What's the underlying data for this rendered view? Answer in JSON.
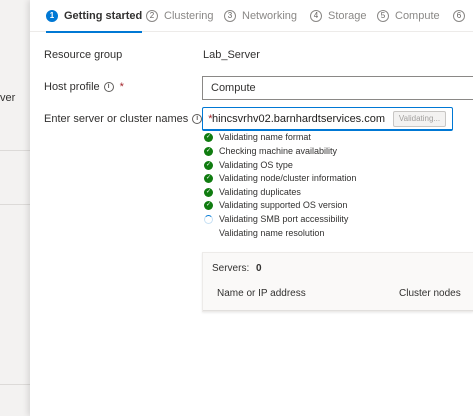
{
  "background": {
    "left_text": "ver"
  },
  "steps": [
    {
      "num": "1",
      "label": "Getting started",
      "active": true
    },
    {
      "num": "2",
      "label": "Clustering"
    },
    {
      "num": "3",
      "label": "Networking"
    },
    {
      "num": "4",
      "label": "Storage"
    },
    {
      "num": "5",
      "label": "Compute"
    },
    {
      "num": "6",
      "label": ""
    }
  ],
  "form": {
    "resource_group_label": "Resource group",
    "resource_group_value": "Lab_Server",
    "host_profile_label": "Host profile",
    "host_profile_value": "Compute",
    "names_label": "Enter server or cluster names",
    "names_value": "hincsvrhv02.barnhardtservices.com",
    "validating_button": "Validating...",
    "required_mark": "*",
    "info_glyph": "i"
  },
  "validations": [
    {
      "text": "Validating name format",
      "status": "done"
    },
    {
      "text": "Checking machine availability",
      "status": "done"
    },
    {
      "text": "Validating OS type",
      "status": "done"
    },
    {
      "text": "Validating node/cluster information",
      "status": "done"
    },
    {
      "text": "Validating duplicates",
      "status": "done"
    },
    {
      "text": "Validating supported OS version",
      "status": "done"
    },
    {
      "text": "Validating SMB port accessibility",
      "status": "in-progress"
    },
    {
      "text": "Validating name resolution",
      "status": "pending"
    }
  ],
  "servers": {
    "label": "Servers:",
    "count": "0",
    "col_name": "Name or IP address",
    "col_nodes": "Cluster nodes"
  },
  "colors": {
    "accent": "#0078d4",
    "success": "#107c10",
    "required": "#a4262c"
  }
}
